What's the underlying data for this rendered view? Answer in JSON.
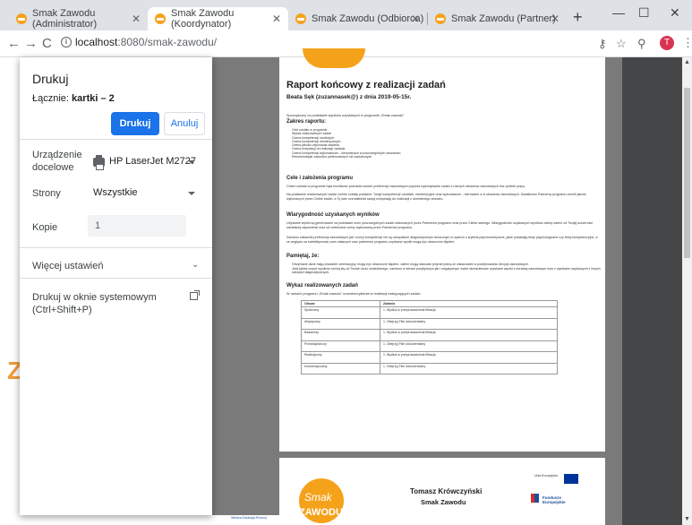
{
  "browser": {
    "tabs": [
      {
        "label": "Smak Zawodu (Administrator)",
        "active": false
      },
      {
        "label": "Smak Zawodu (Koordynator)",
        "active": true
      },
      {
        "label": "Smak Zawodu (Odbiorca)",
        "active": false
      },
      {
        "label": "Smak Zawodu (Partner)",
        "active": false
      }
    ],
    "new_tab": "+",
    "window_controls": {
      "minimize": "—",
      "maximize": "☐",
      "close": "✕"
    },
    "url_host": "localhost",
    "url_rest": ":8080/smak-zawodu/",
    "avatar_initial": "T"
  },
  "print_dialog": {
    "title": "Drukuj",
    "total_label": "Łącznie:",
    "total_value": "kartki – 2",
    "print_button": "Drukuj",
    "cancel_button": "Anuluj",
    "destination_label": "Urządzenie docelowe",
    "destination_value": "HP LaserJet M2727",
    "pages_label": "Strony",
    "pages_value": "Wszystkie",
    "copies_label": "Kopie",
    "copies_value": "1",
    "more_settings": "Więcej ustawień",
    "system_dialog": "Drukuj w oknie systemowym (Ctrl+Shift+P)"
  },
  "document": {
    "title": "Raport końcowy z realizacji zadań",
    "author": "Beata Sęk (zuzannasek@) z dnia 2019-05-15r.",
    "intro": "Sporządzony na podstawie wyników uzyskanych w programie „Smak zawodu”",
    "toc_heading": "Zakres raportu:",
    "toc_items": [
      "Cele udziału w programie",
      "Wykaz realizowanych zadań",
      "Ocena kompetencji osobistych",
      "Ocena kompetencji menterycznych",
      "Ocena jakości wykonania zadania",
      "Ocena motywacji do realizacji zadania",
      "Ocena kompetencji wykonawców – kierowanych w poszczególnych obszarach",
      "Rekomendacje zawodów preferowanych niż zawodowych"
    ],
    "goals_heading": "Cele i założenia programu",
    "goals_p1": "Celem udziału w programie była możliwość poznania swoich preferencji zawodowych poprzez wykonywanie zadań z różnych obszarów zawodowych tzw. próbek pracy.",
    "goals_p2": "Na podstawie realizowanych zadań ocenie zostały poddane: Twoje kompetencje osobiste, menterycyjne oraz wykonawcze – kierowane w 6 obszarów zawodowych. Dodatkowo Partnerzy programu ocenili jakość wykonanych przez Ciebie zadań, a Ty sam oceniałeś/aś swoją motywację do realizacji z określonego obszaru.",
    "results_heading": "Wiarygodność uzyskanych wyników",
    "results_p1": "Uzyskane wyniki są generowane na podstawie ocen poszczególnych zadań dokonanych przez Partnerów programu oraz przez Ciebie samego. Wiarygodność uzyskanych wyników zależy zatem od Twojej szczerości udzielanej odpowiedzi oraz od rzetelności oceny wykonawcy przez Partnerów programu.",
    "results_p2": "Zarówno wskaźnik preferencji zawodowych jak i oceny kompetencji nie są narzędziem diagnostycznym tworzonym w oparciu o kryteria psychometryczne, jakie posiadają testy psychologiczne czy testy kompetencyjne, a ze względu na subiektywność ocen własnych oraz partnerów programu uzyskane wyniki mogą być obarczone błędem.",
    "remember_heading": "Pamiętaj, że:",
    "remember_items": [
      "Otrzymane dane mają charakter orientacyjny, mogą być obarczone błędem, zatem mogą stanowić jedynie jedną ze wskazówek w podejmowaniu decyzji zawodowych.",
      "Jeśli jakieś części wyników różnią się od Twoich dużo znaleźionego, zarówno w sensie pozytywnym jak i negatywnym warto skonsultować uzyskane wyniki z doradcą zawodowym oraz z wynikami uzyskanymi z innych narzędzi diagnostycznych."
    ],
    "tasks_heading": "Wykaz realizowanych zadań",
    "tasks_intro": "W ramach programu „Smak zawodu” uczestniczyłeś/aś w realizacji następujących zadań:",
    "table_headers": [
      "Obszar",
      "Zadania"
    ],
    "table_rows": [
      [
        "Społeczny",
        "1. Wydłuż w przeprowadzenia filtracja"
      ],
      [
        "Artystyczny",
        "1. Obejrzyj Film dokumentalny"
      ],
      [
        "Badawczy",
        "1. Wydłuż w przeprowadzenia filtracja"
      ],
      [
        "Przedsiębiorczy",
        "1. Obejrzyj Film dokumentalny"
      ],
      [
        "Realistyczny",
        "1. Wydłuż w przeprowadzenia filtracja"
      ],
      [
        "Konwencjonalny",
        "1. Obejrzyj Film dokumentalny"
      ]
    ],
    "footer_name": "Tomasz Krówczyński",
    "footer_brand": "Smak Zawodu",
    "logo_word1": "Smak",
    "logo_word2": "ZAWODU",
    "eu_label": "Unia Europejska",
    "fe_label_line1": "Fundusze",
    "fe_label_line2": "Europejskie",
    "bottom_text": "Wiedza Edukacja Rozwój",
    "bg_letter": "Z"
  }
}
